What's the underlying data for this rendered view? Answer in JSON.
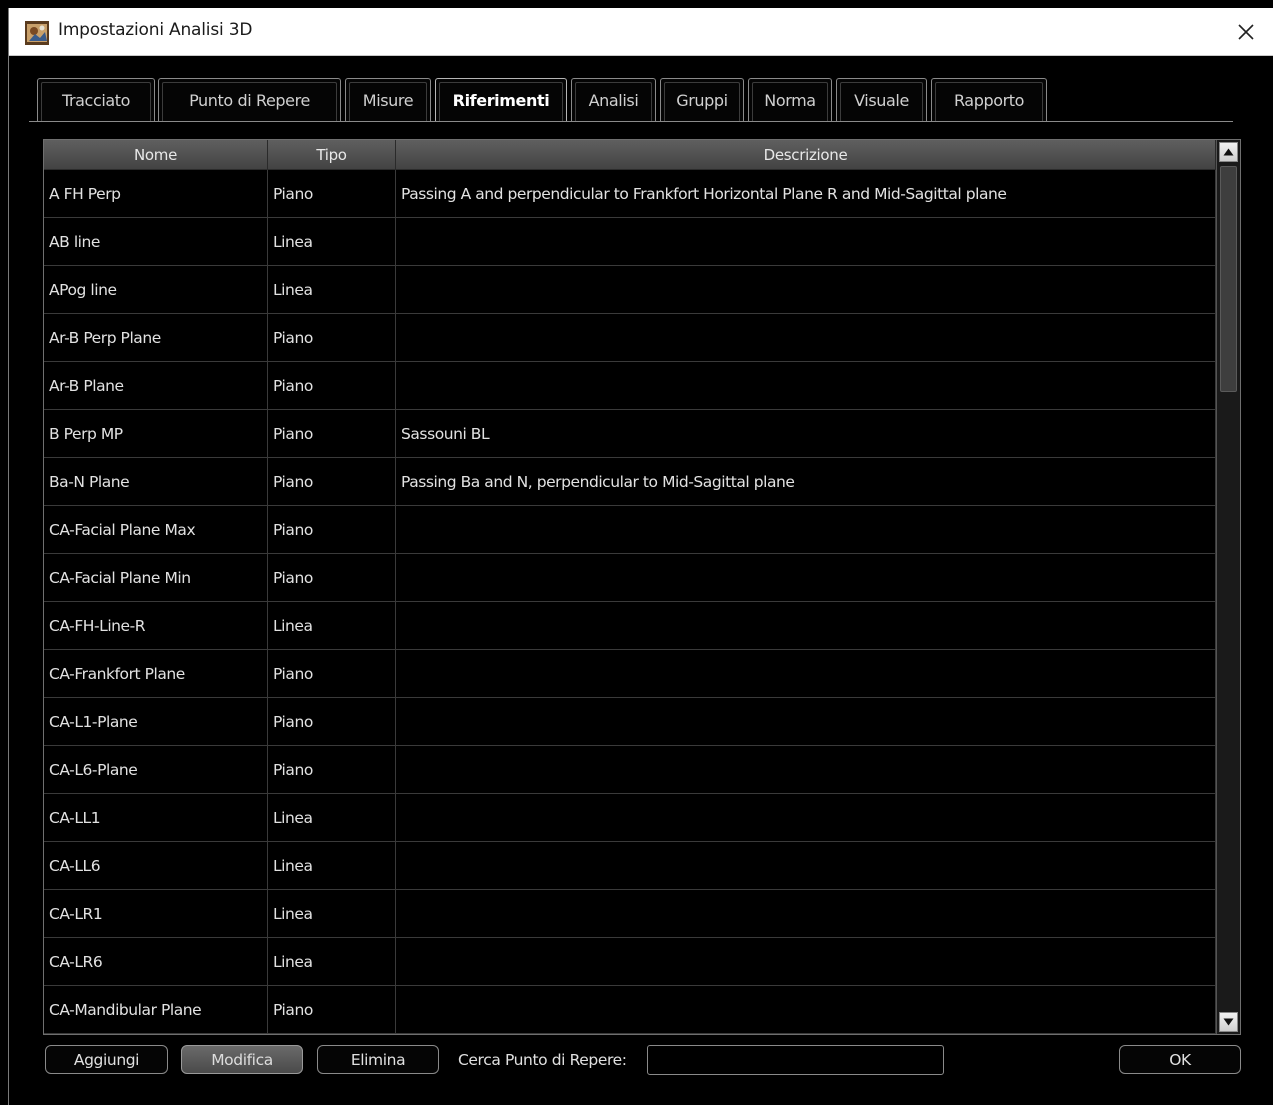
{
  "window": {
    "title": "Impostazioni Analisi 3D",
    "app_icon": "app-logo-icon",
    "close_icon": "close-icon"
  },
  "tabs": [
    {
      "label": "Tracciato",
      "active": false
    },
    {
      "label": "Punto di Repere",
      "active": false
    },
    {
      "label": "Misure",
      "active": false
    },
    {
      "label": "Riferimenti",
      "active": true
    },
    {
      "label": "Analisi",
      "active": false
    },
    {
      "label": "Gruppi",
      "active": false
    },
    {
      "label": "Norma",
      "active": false
    },
    {
      "label": "Visuale",
      "active": false
    },
    {
      "label": "Rapporto",
      "active": false
    }
  ],
  "table": {
    "columns": [
      "Nome",
      "Tipo",
      "Descrizione"
    ],
    "rows": [
      {
        "nome": "A FH Perp",
        "tipo": "Piano",
        "descrizione": "Passing A and perpendicular to Frankfort Horizontal Plane R and Mid-Sagittal plane"
      },
      {
        "nome": "AB line",
        "tipo": "Linea",
        "descrizione": ""
      },
      {
        "nome": "APog line",
        "tipo": "Linea",
        "descrizione": ""
      },
      {
        "nome": "Ar-B Perp Plane",
        "tipo": "Piano",
        "descrizione": ""
      },
      {
        "nome": "Ar-B Plane",
        "tipo": "Piano",
        "descrizione": ""
      },
      {
        "nome": "B Perp MP",
        "tipo": "Piano",
        "descrizione": "Sassouni BL"
      },
      {
        "nome": "Ba-N Plane",
        "tipo": "Piano",
        "descrizione": "Passing Ba and N, perpendicular to Mid-Sagittal plane"
      },
      {
        "nome": "CA-Facial Plane Max",
        "tipo": "Piano",
        "descrizione": ""
      },
      {
        "nome": "CA-Facial Plane Min",
        "tipo": "Piano",
        "descrizione": ""
      },
      {
        "nome": "CA-FH-Line-R",
        "tipo": "Linea",
        "descrizione": ""
      },
      {
        "nome": "CA-Frankfort Plane",
        "tipo": "Piano",
        "descrizione": ""
      },
      {
        "nome": "CA-L1-Plane",
        "tipo": "Piano",
        "descrizione": ""
      },
      {
        "nome": "CA-L6-Plane",
        "tipo": "Piano",
        "descrizione": ""
      },
      {
        "nome": "CA-LL1",
        "tipo": "Linea",
        "descrizione": ""
      },
      {
        "nome": "CA-LL6",
        "tipo": "Linea",
        "descrizione": ""
      },
      {
        "nome": "CA-LR1",
        "tipo": "Linea",
        "descrizione": ""
      },
      {
        "nome": "CA-LR6",
        "tipo": "Linea",
        "descrizione": ""
      },
      {
        "nome": "CA-Mandibular Plane",
        "tipo": "Piano",
        "descrizione": ""
      }
    ]
  },
  "scrollbar": {
    "up_icon": "scroll-up-arrow-icon",
    "down_icon": "scroll-down-arrow-icon"
  },
  "footer": {
    "add_label": "Aggiungi",
    "edit_label": "Modifica",
    "delete_label": "Elimina",
    "search_label": "Cerca Punto di Repere:",
    "search_value": "",
    "ok_label": "OK"
  }
}
